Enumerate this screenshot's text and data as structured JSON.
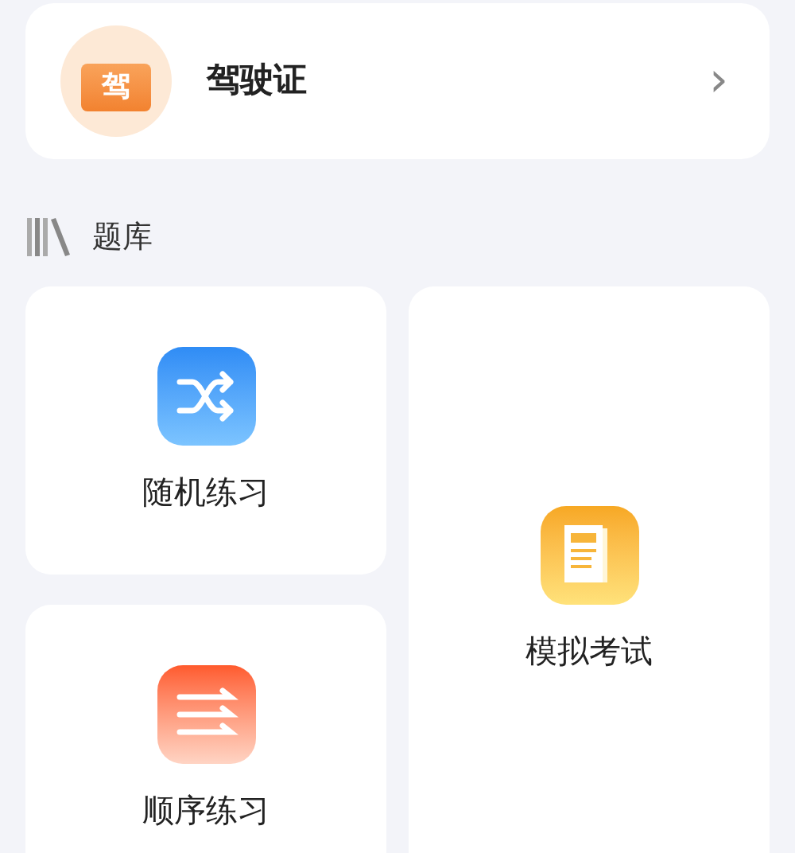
{
  "license_card": {
    "badge": "驾",
    "title": "驾驶证",
    "chevron": "›"
  },
  "section": {
    "title": "题库"
  },
  "tiles": [
    {
      "kind": "random",
      "label": "随机练习"
    },
    {
      "kind": "exam",
      "label": "模拟考试"
    },
    {
      "kind": "order",
      "label": "顺序练习"
    }
  ]
}
